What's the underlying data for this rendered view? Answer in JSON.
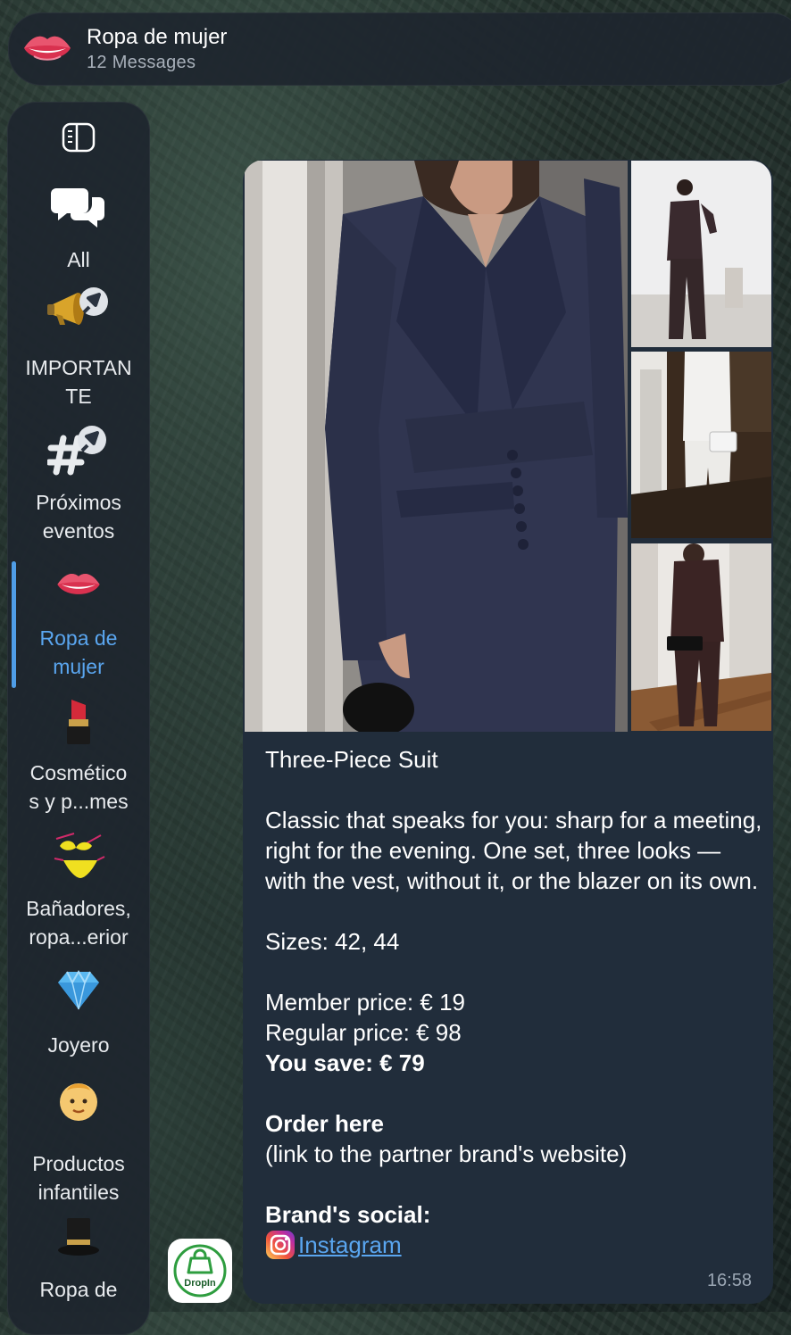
{
  "header": {
    "title": "Ropa de mujer",
    "subtitle": "12 Messages",
    "avatar_icon": "lips-icon"
  },
  "sidebar": {
    "toggle_icon": "sidebar-toggle-icon",
    "active_color": "#5aa6f0",
    "folders": [
      {
        "label_1": "All",
        "label_2": "",
        "icon": "chat-bubbles-icon"
      },
      {
        "label_1": "IMPORTAN",
        "label_2": "TE",
        "icon": "megaphone-pin-icon"
      },
      {
        "label_1": "Próximos",
        "label_2": "eventos",
        "icon": "hashtag-pin-icon"
      },
      {
        "label_1": "Ropa de",
        "label_2": "mujer",
        "icon": "lips-icon",
        "active": true
      },
      {
        "label_1": "Cosmético",
        "label_2": "s y p...mes",
        "icon": "lipstick-icon"
      },
      {
        "label_1": "Bañadores,",
        "label_2": "ropa...erior",
        "icon": "bikini-icon"
      },
      {
        "label_1": "Joyero",
        "label_2": "",
        "icon": "gem-icon"
      },
      {
        "label_1": "Productos",
        "label_2": "infantiles",
        "icon": "baby-icon"
      },
      {
        "label_1": "Ropa de",
        "label_2": "",
        "icon": "top-hat-icon"
      }
    ]
  },
  "message": {
    "title": "Three-Piece Suit",
    "description": "Classic that speaks for you: sharp for a meeting, right for the evening. One set, three looks — with the vest, without it, or the blazer on its own.",
    "sizes": "Sizes: 42, 44",
    "member_price": "Member price: € 19",
    "regular_price": "Regular price: € 98",
    "you_save": "You save: € 79",
    "order_heading": "Order here",
    "order_note": "(link to the partner brand's website)",
    "social_heading": "Brand's social:",
    "social_link": "Instagram",
    "time": "16:58",
    "photos": [
      "navy-suit-closeup-photo",
      "dark-suit-full-photo",
      "white-suit-photo",
      "brown-suit-photo"
    ]
  },
  "sender": {
    "avatar_text": "DropIn",
    "brand_color": "#2e9d3f"
  }
}
